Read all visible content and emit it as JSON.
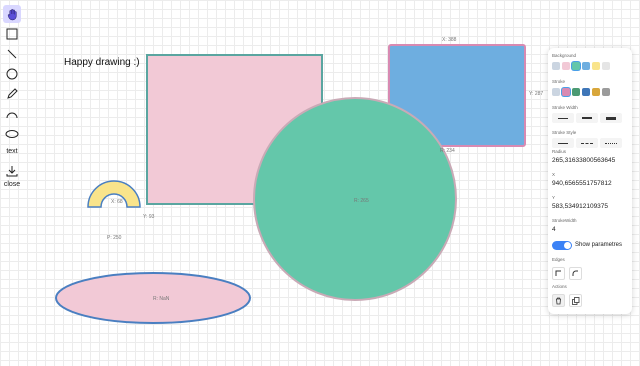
{
  "toolbar": {
    "tools": [
      {
        "name": "hand-icon"
      },
      {
        "name": "rectangle-icon"
      },
      {
        "name": "line-icon"
      },
      {
        "name": "circle-icon"
      },
      {
        "name": "pencil-icon"
      },
      {
        "name": "arc-icon"
      },
      {
        "name": "ellipse-icon"
      }
    ],
    "text_label": "text",
    "close_label": "close",
    "download_icon": "download-icon"
  },
  "canvas": {
    "greeting": "Happy drawing :)",
    "rect_pink_color": "#f2c9d6",
    "rect_pink_border": "#5aa5a0",
    "rect_blue_color": "#6eaee0",
    "rect_blue_border": "#d88ab2",
    "circle_color": "#64c7aa",
    "circle_border": "#c9aab6",
    "arc_color": "#f9e48b",
    "arc_border": "#4a7fc1",
    "ellipse_color": "#f2c9d6",
    "ellipse_border": "#4a7fc1",
    "labels": {
      "blue_rect_top": "X: 388",
      "blue_rect_right": "Y: 287",
      "circle_top": "R: 234",
      "circle_center": "R: 265",
      "arc_center": "X: 68",
      "arc_below": "Y: 93",
      "arc_r": "P: 250",
      "ellipse_center": "R: NaN"
    }
  },
  "panel": {
    "background_title": "Background",
    "background_swatches": [
      "#cbd5e1",
      "#f2c9d6",
      "#64c7aa",
      "#6eaee0",
      "#f9e48b",
      "#e5e5e5"
    ],
    "stroke_title": "Stroke",
    "stroke_swatches": [
      "#cbd5e1",
      "#d88ab2",
      "#4b9a73",
      "#3f76b8",
      "#d8a63a",
      "#9b9b9b"
    ],
    "stroke_width_title": "Stroke Width",
    "stroke_style_title": "Stroke Style",
    "radius_title": "Radius",
    "radius_value": "265,31633800563645",
    "x_title": "X",
    "x_value": "940,6565551757812",
    "y_title": "Y",
    "y_value": "583,534912109375",
    "stroke_width_value_title": "StrokeWidth",
    "stroke_width_value": "4",
    "show_parameters_label": "Show parametres",
    "edges_title": "Edges",
    "actions_title": "Actions"
  }
}
